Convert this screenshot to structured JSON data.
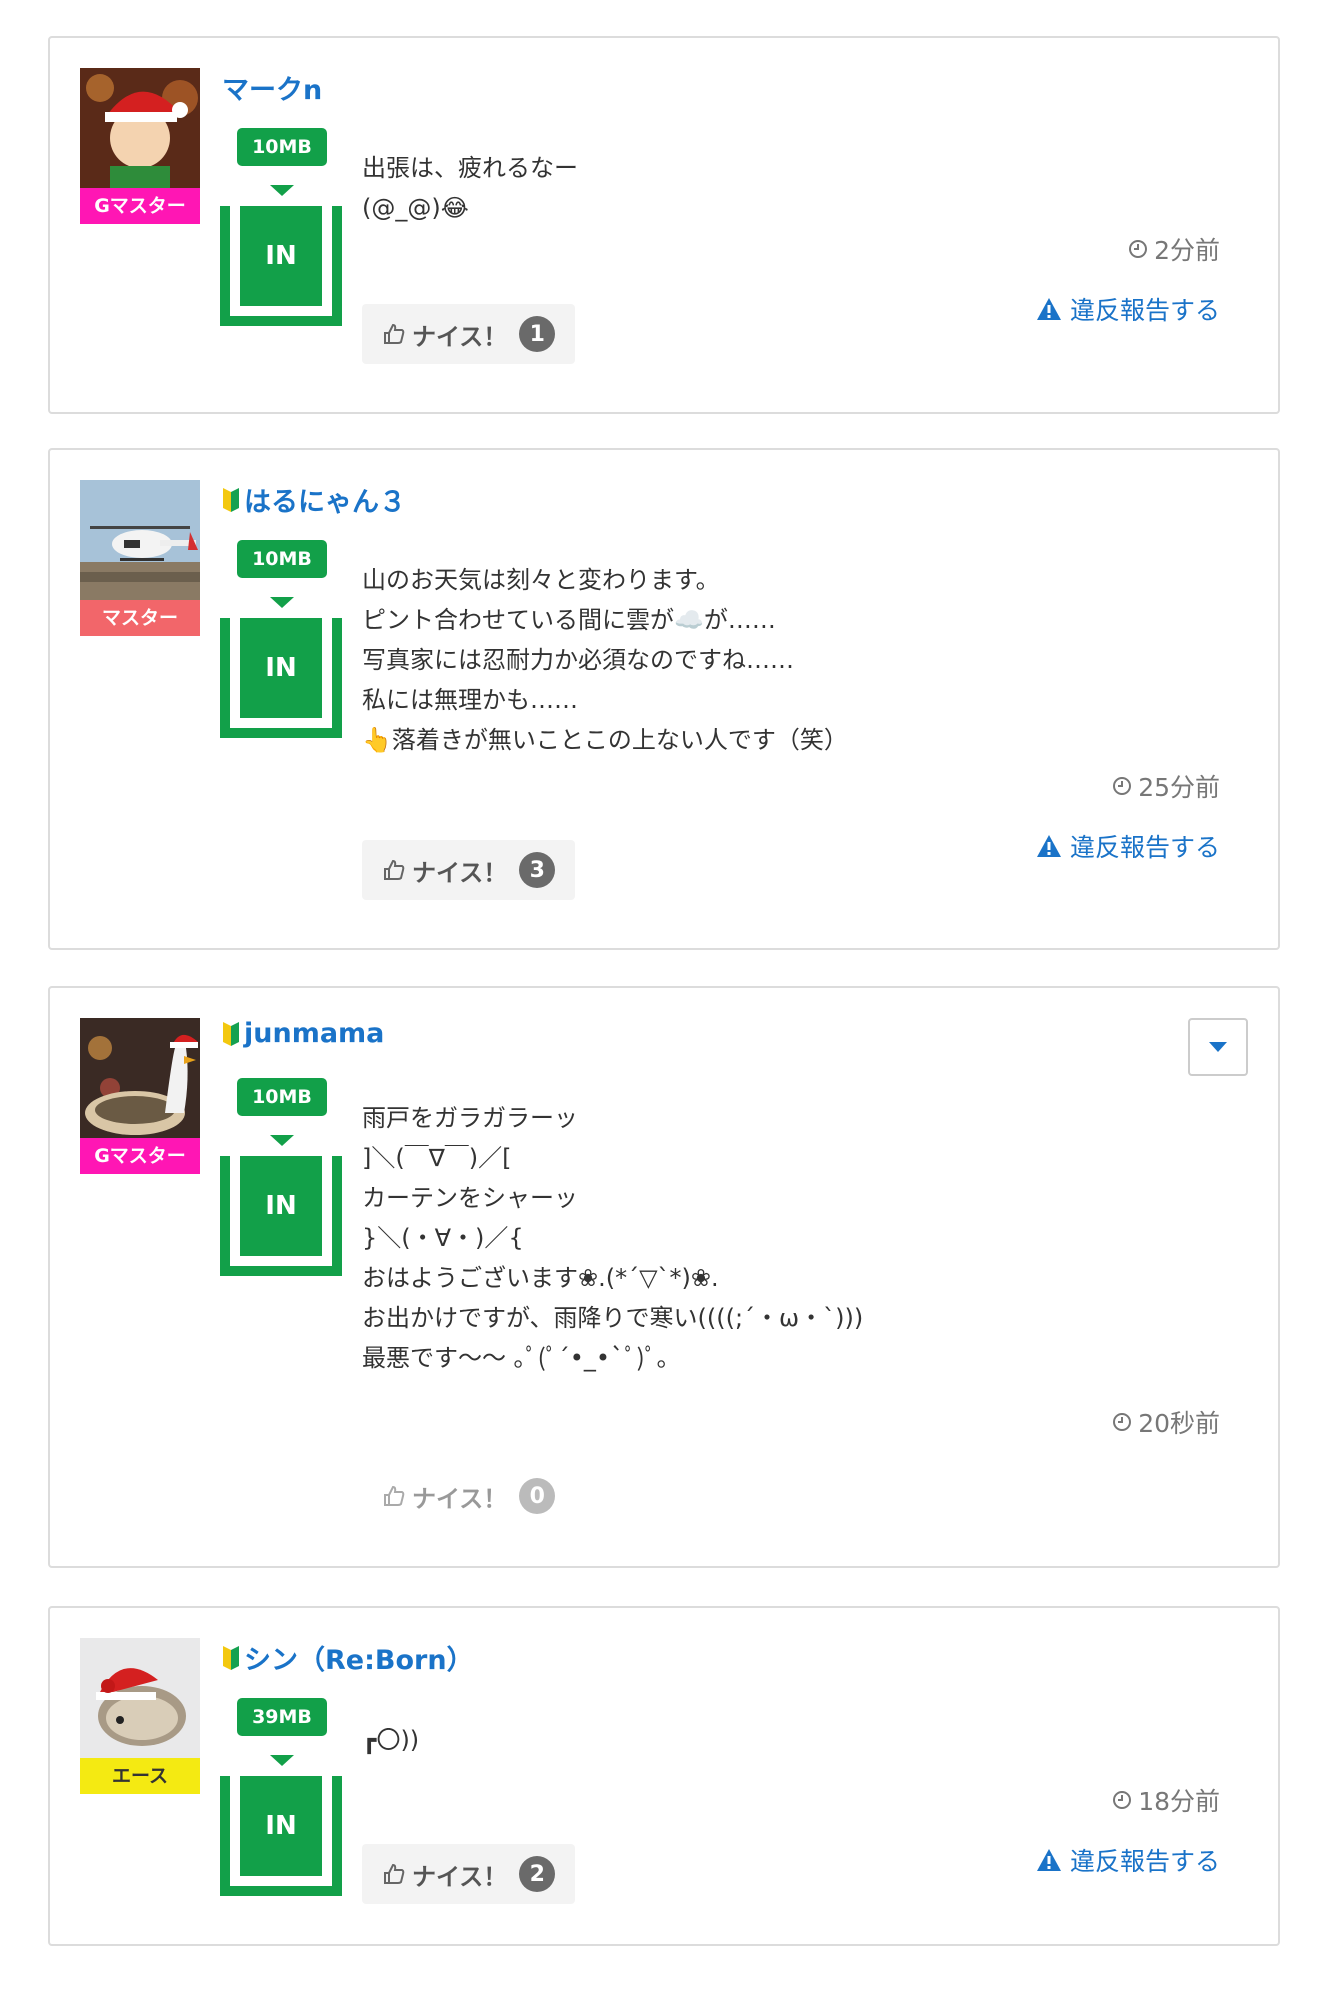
{
  "posts": [
    {
      "username": "マークn",
      "beginner": false,
      "rank": "Gマスター",
      "rank_color": "#ff16b4",
      "rank_text_color": "#ffffff",
      "mb": "10MB",
      "in_label": "IN",
      "message": [
        "出張は、疲れるなー",
        "(@_@)😂"
      ],
      "time": "2分前",
      "report_label": "違反報告する",
      "nice_label": "ナイス！",
      "nice_count": "1"
    },
    {
      "username": "はるにゃん３",
      "beginner": true,
      "rank": "マスター",
      "rank_color": "#f2666a",
      "rank_text_color": "#ffffff",
      "mb": "10MB",
      "in_label": "IN",
      "message": [
        "山のお天気は刻々と変わります。",
        "ピント合わせている間に雲が☁️が……",
        "写真家には忍耐力か必須なのですね……",
        "私には無理かも……",
        "👆落着きが無いことこの上ない人です（笑）"
      ],
      "time": "25分前",
      "report_label": "違反報告する",
      "nice_label": "ナイス！",
      "nice_count": "3"
    },
    {
      "username": "junmama",
      "beginner": true,
      "rank": "Gマスター",
      "rank_color": "#ff16b4",
      "rank_text_color": "#ffffff",
      "mb": "10MB",
      "in_label": "IN",
      "message": [
        "雨戸をガラガラーッ",
        "]＼(￣∇￣)／[",
        "カーテンをシャーッ",
        "}＼(・∀・)／{",
        "おはようございます❀.(*´▽`*)❀.",
        "お出かけですが、雨降りで寒い((((;´・ω・`)))",
        "最悪です〜〜 ｡ﾟ(ﾟ´•_•`ﾟ)ﾟ｡"
      ],
      "time": "20秒前",
      "nice_label": "ナイス！",
      "nice_count": "0"
    },
    {
      "username": "シン（Re:Born）",
      "beginner": true,
      "rank": "エース",
      "rank_color": "#f4ea12",
      "rank_text_color": "#333333",
      "mb": "39MB",
      "in_label": "IN",
      "message": [
        "┏〇))"
      ],
      "time": "18分前",
      "report_label": "違反報告する",
      "nice_label": "ナイス！",
      "nice_count": "2"
    }
  ]
}
